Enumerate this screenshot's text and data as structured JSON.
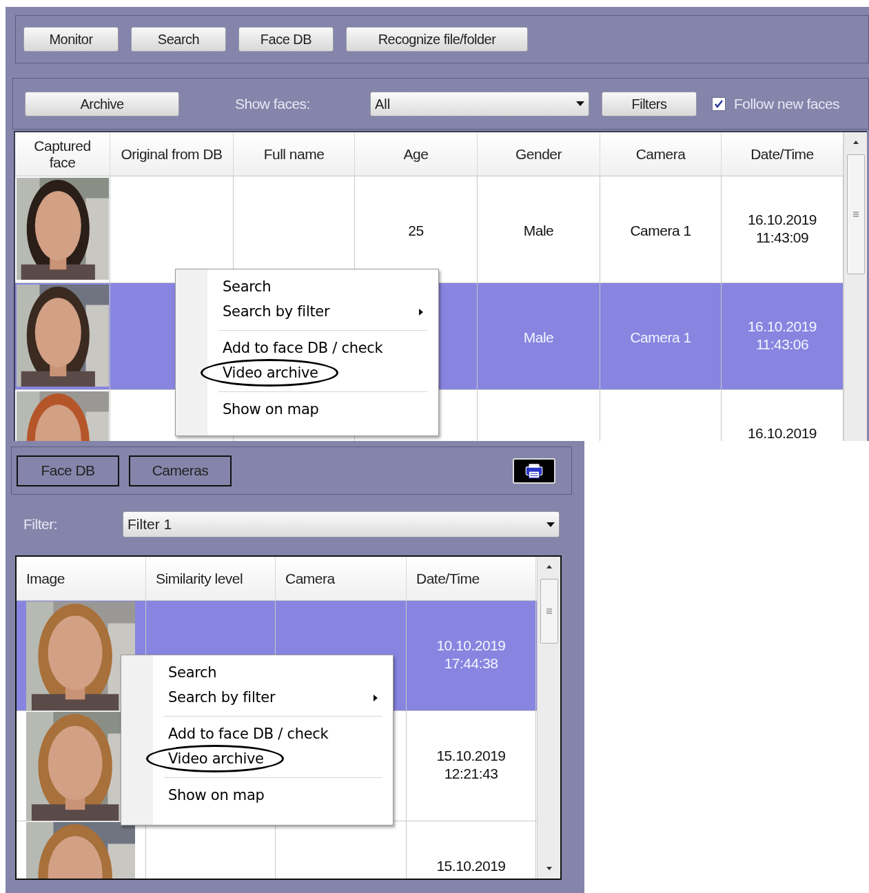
{
  "top_panel": {
    "nav_buttons": [
      "Monitor",
      "Search",
      "Face DB",
      "Recognize file/folder"
    ],
    "toolbar": {
      "archive_button": "Archive",
      "show_faces_label": "Show faces:",
      "show_faces_value": "All",
      "filters_button": "Filters",
      "follow_new_faces": {
        "label": "Follow new faces",
        "checked": true
      }
    },
    "table": {
      "columns": [
        "Captured face",
        "Original from DB",
        "Full name",
        "Age",
        "Gender",
        "Camera",
        "Date/Time"
      ],
      "rows": [
        {
          "age": "25",
          "gender": "Male",
          "camera": "Camera 1",
          "date": "16.10.2019",
          "time": "11:43:09",
          "selected": false
        },
        {
          "gender": "Male",
          "camera": "Camera 1",
          "date": "16.10.2019",
          "time": "11:43:06",
          "selected": true
        },
        {
          "date": "16.10.2019",
          "selected": false
        }
      ]
    },
    "context_menu": {
      "items": [
        {
          "label": "Search",
          "kind": "item",
          "separator_before": false,
          "circled": false
        },
        {
          "label": "Search by filter",
          "kind": "submenu",
          "separator_before": false,
          "circled": false
        },
        {
          "label": "Add to face DB / check",
          "kind": "item",
          "separator_before": true,
          "circled": false
        },
        {
          "label": "Video archive",
          "kind": "item",
          "separator_before": false,
          "circled": true
        },
        {
          "label": "Show on map",
          "kind": "item",
          "separator_before": true,
          "circled": false
        }
      ]
    }
  },
  "bottom_panel": {
    "tabs": [
      "Face DB",
      "Cameras"
    ],
    "filter": {
      "label": "Filter:",
      "value": "Filter 1"
    },
    "table": {
      "columns": [
        "Image",
        "Similarity level",
        "Camera",
        "Date/Time"
      ],
      "rows": [
        {
          "date": "10.10.2019",
          "time": "17:44:38",
          "selected": true
        },
        {
          "date": "15.10.2019",
          "time": "12:21:43",
          "selected": false
        },
        {
          "date": "15.10.2019",
          "selected": false
        }
      ]
    },
    "context_menu": {
      "items": [
        {
          "label": "Search",
          "kind": "item",
          "separator_before": false,
          "circled": false
        },
        {
          "label": "Search by filter",
          "kind": "submenu",
          "separator_before": false,
          "circled": false
        },
        {
          "label": "Add to face DB / check",
          "kind": "item",
          "separator_before": true,
          "circled": false
        },
        {
          "label": "Video archive",
          "kind": "item",
          "separator_before": false,
          "circled": true
        },
        {
          "label": "Show on map",
          "kind": "item",
          "separator_before": true,
          "circled": false
        }
      ]
    }
  }
}
